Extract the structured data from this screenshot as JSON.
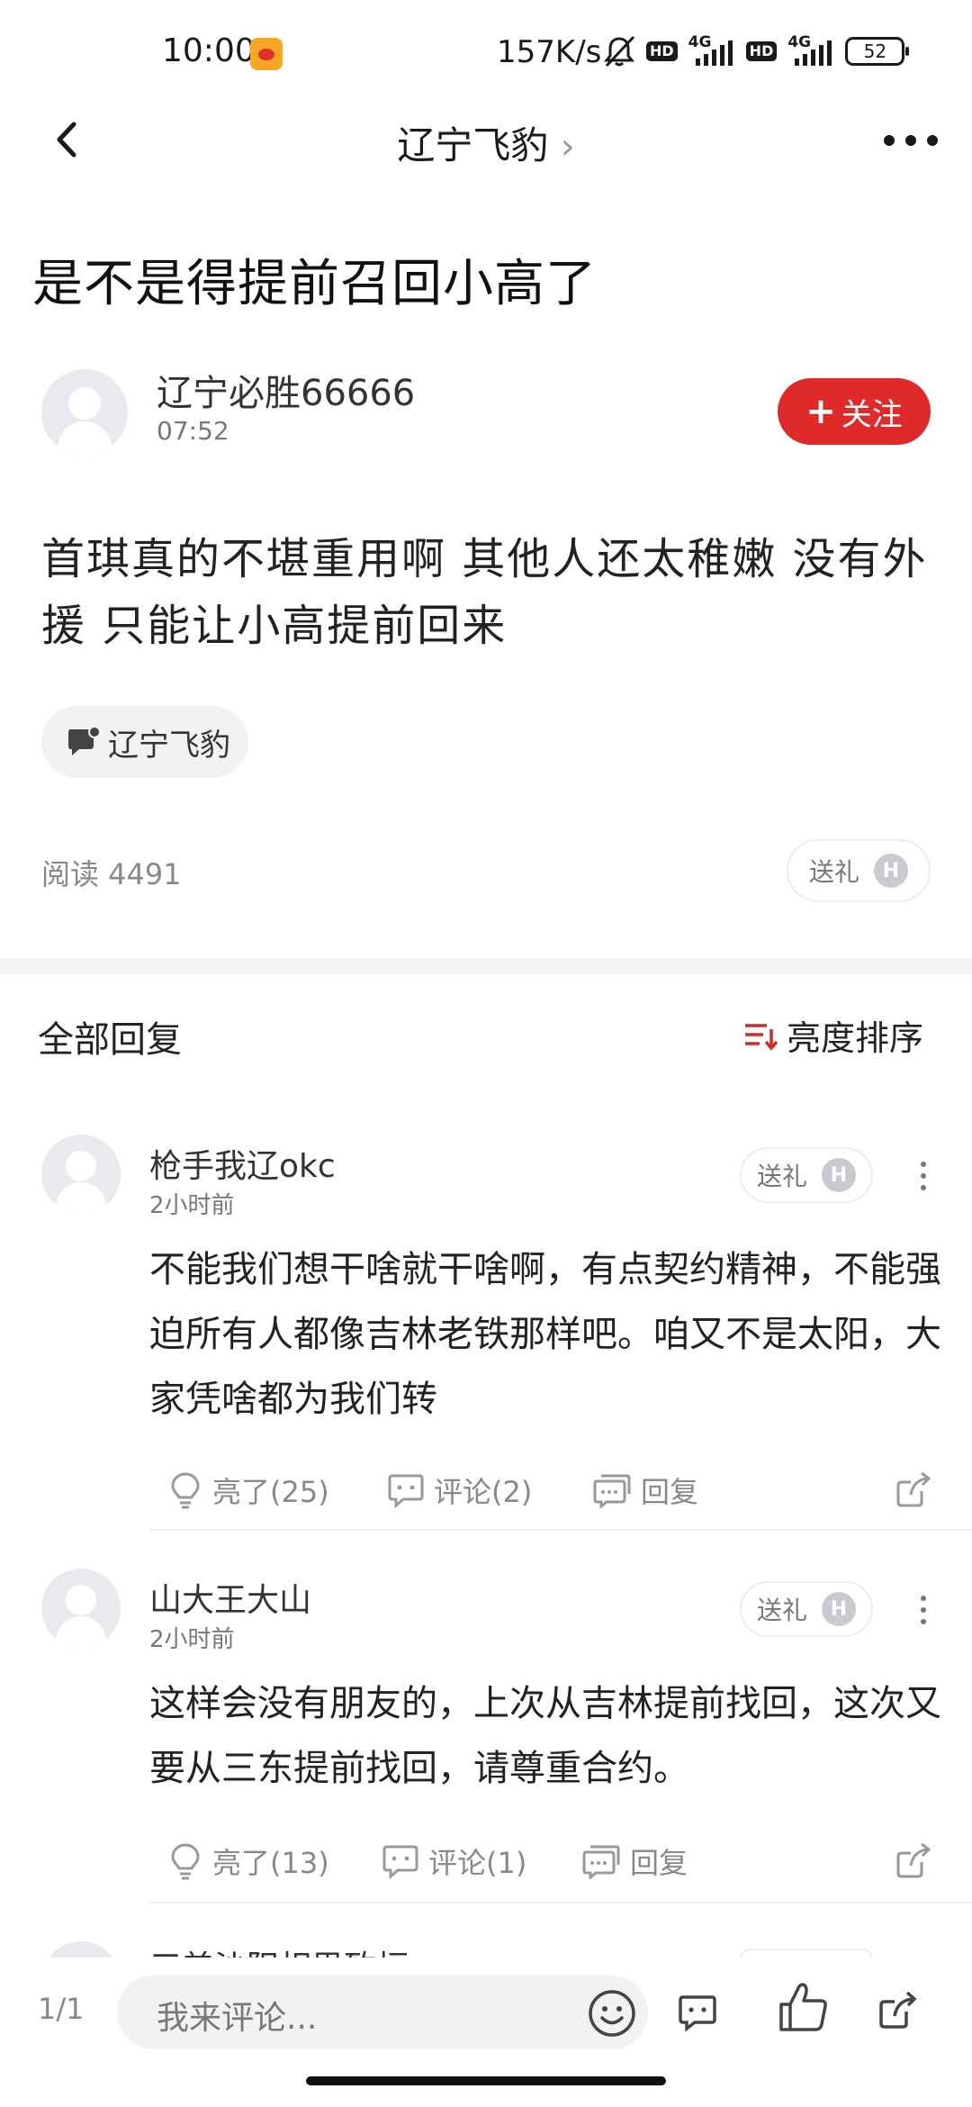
{
  "status_bar": {
    "time": "10:00",
    "net_speed": "157K/s",
    "sim1_hd": "HD",
    "sim1_net": "4G",
    "sim2_hd": "HD",
    "sim2_net": "4G",
    "battery": "52",
    "icons": [
      "weibo-icon",
      "mute-icon",
      "signal-icon",
      "battery-icon"
    ]
  },
  "nav": {
    "title": "辽宁飞豹",
    "title_chevron": "›"
  },
  "post": {
    "title": "是不是得提前召回小高了",
    "author": "辽宁必胜66666",
    "time": "07:52",
    "follow_label": "关注",
    "follow_plus": "+",
    "body": "首琪真的不堪重用啊 其他人还太稚嫩 没有外援 只能让小高提前回来",
    "tag": "辽宁飞豹",
    "read_count": "阅读 4491",
    "gift_label": "送礼",
    "gift_badge": "H"
  },
  "replies": {
    "section_title": "全部回复",
    "sort_label": "亮度排序",
    "items": [
      {
        "name": "枪手我辽okc",
        "time": "2小时前",
        "text": "不能我们想干啥就干啥啊，有点契约精神，不能强迫所有人都像吉林老铁那样吧。咱又不是太阳，大家凭啥都为我们转",
        "gift_label": "送礼",
        "gift_badge": "H",
        "like_label": "亮了(25)",
        "comment_label": "评论(2)",
        "reply_label": "回复"
      },
      {
        "name": "山大王大山",
        "time": "2小时前",
        "text": "这样会没有朋友的，上次从吉林提前找回，这次又要从三东提前找回，请尊重合约。",
        "gift_label": "送礼",
        "gift_badge": "H",
        "like_label": "亮了(13)",
        "comment_label": "评论(1)",
        "reply_label": "回复"
      }
    ],
    "peek_name": "三美沙阳相思致桓"
  },
  "bottom_bar": {
    "page_indicator": "1/1",
    "input_placeholder": "我来评论...",
    "icons": [
      "emoji-icon",
      "comment-icon",
      "like-icon",
      "share-icon"
    ]
  },
  "colors": {
    "accent_red": "#e02a2a",
    "text_primary": "#1a1a1a",
    "text_secondary": "#888888"
  }
}
